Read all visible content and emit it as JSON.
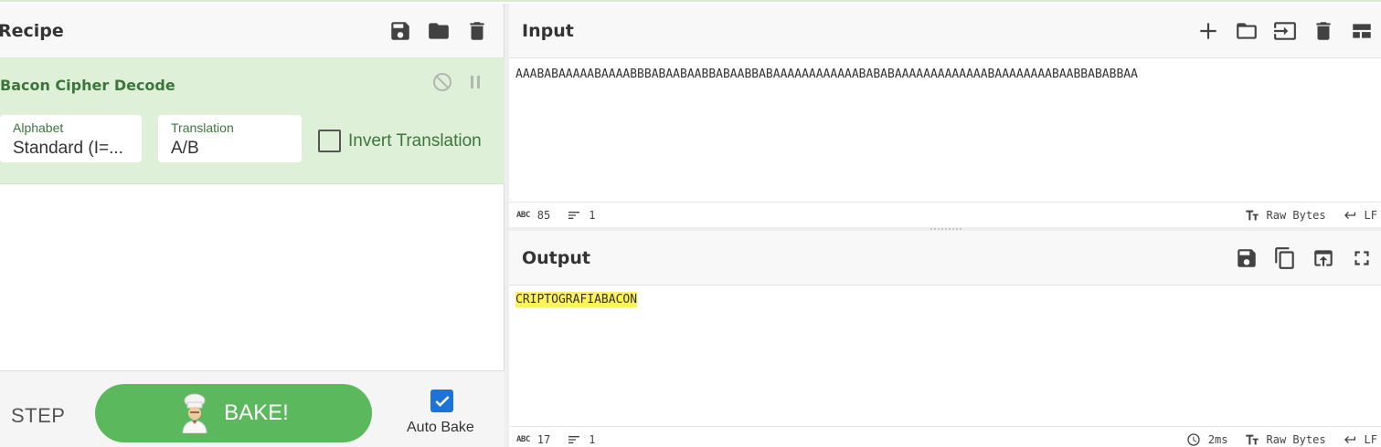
{
  "recipe": {
    "title": "Recipe",
    "header_icons": [
      "save-icon",
      "folder-icon",
      "trash-icon"
    ]
  },
  "operation": {
    "title": "Bacon Cipher Decode",
    "alphabet_label": "Alphabet",
    "alphabet_value": "Standard (I=...",
    "translation_label": "Translation",
    "translation_value": "A/B",
    "invert_label": "Invert Translation",
    "invert_checked": false
  },
  "controls": {
    "step_label": "STEP",
    "bake_label": "BAKE!",
    "auto_bake_label": "Auto Bake",
    "auto_bake_checked": true
  },
  "input": {
    "title": "Input",
    "text": "AAABABAAAAABAAAABBBABAABAABBABAABBABAAAAAAAAAAAABABABAAAAAAAAAAAAABAAAAAAAABAABBABABBAA",
    "length": "85",
    "lines": "1",
    "encoding": "Raw Bytes",
    "eol": "LF"
  },
  "output": {
    "title": "Output",
    "text": "CRIPTOGRAFIABACON",
    "length": "17",
    "lines": "1",
    "time": "2ms",
    "encoding": "Raw Bytes",
    "eol": "LF"
  },
  "colors": {
    "operation_bg": "#dff0d8",
    "operation_text": "#3c763d",
    "bake_green": "#5cb85c",
    "auto_bake_blue": "#1d74d8",
    "highlight": "#fff35c"
  }
}
